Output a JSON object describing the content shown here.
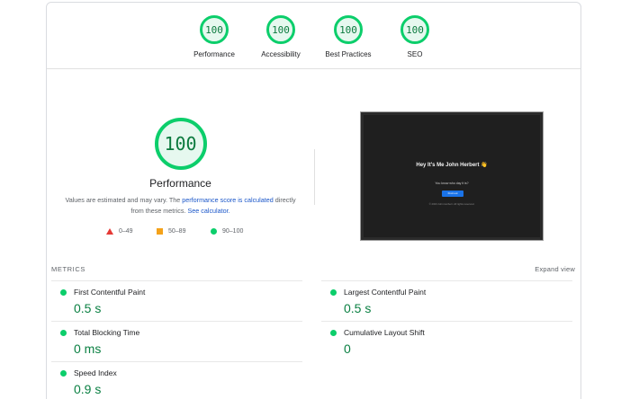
{
  "categories": [
    {
      "score": "100",
      "label": "Performance"
    },
    {
      "score": "100",
      "label": "Accessibility"
    },
    {
      "score": "100",
      "label": "Best Practices"
    },
    {
      "score": "100",
      "label": "SEO"
    }
  ],
  "performance": {
    "score": "100",
    "title": "Performance",
    "desc_prefix": "Values are estimated and may vary. The ",
    "desc_link": "performance score is calculated",
    "desc_mid": " directly from these metrics. ",
    "desc_link2": "See calculator.",
    "colors": {
      "pass": "#0cce6b",
      "average": "#f4a21a",
      "fail": "#e53935"
    }
  },
  "legend": [
    {
      "range": "0–49",
      "shape": "triangle"
    },
    {
      "range": "50–89",
      "shape": "square"
    },
    {
      "range": "90–100",
      "shape": "circle"
    }
  ],
  "screenshot": {
    "heading": "Hey It's Me John Herbert 👋",
    "question": "You know who day it is?",
    "button": "Find out",
    "footer": "© 2023 John Herbert. All rights reserved."
  },
  "metrics": {
    "title": "METRICS",
    "expand": "Expand view",
    "items": [
      {
        "name": "First Contentful Paint",
        "value": "0.5 s"
      },
      {
        "name": "Largest Contentful Paint",
        "value": "0.5 s"
      },
      {
        "name": "Total Blocking Time",
        "value": "0 ms"
      },
      {
        "name": "Cumulative Layout Shift",
        "value": "0"
      },
      {
        "name": "Speed Index",
        "value": "0.9 s"
      }
    ]
  }
}
